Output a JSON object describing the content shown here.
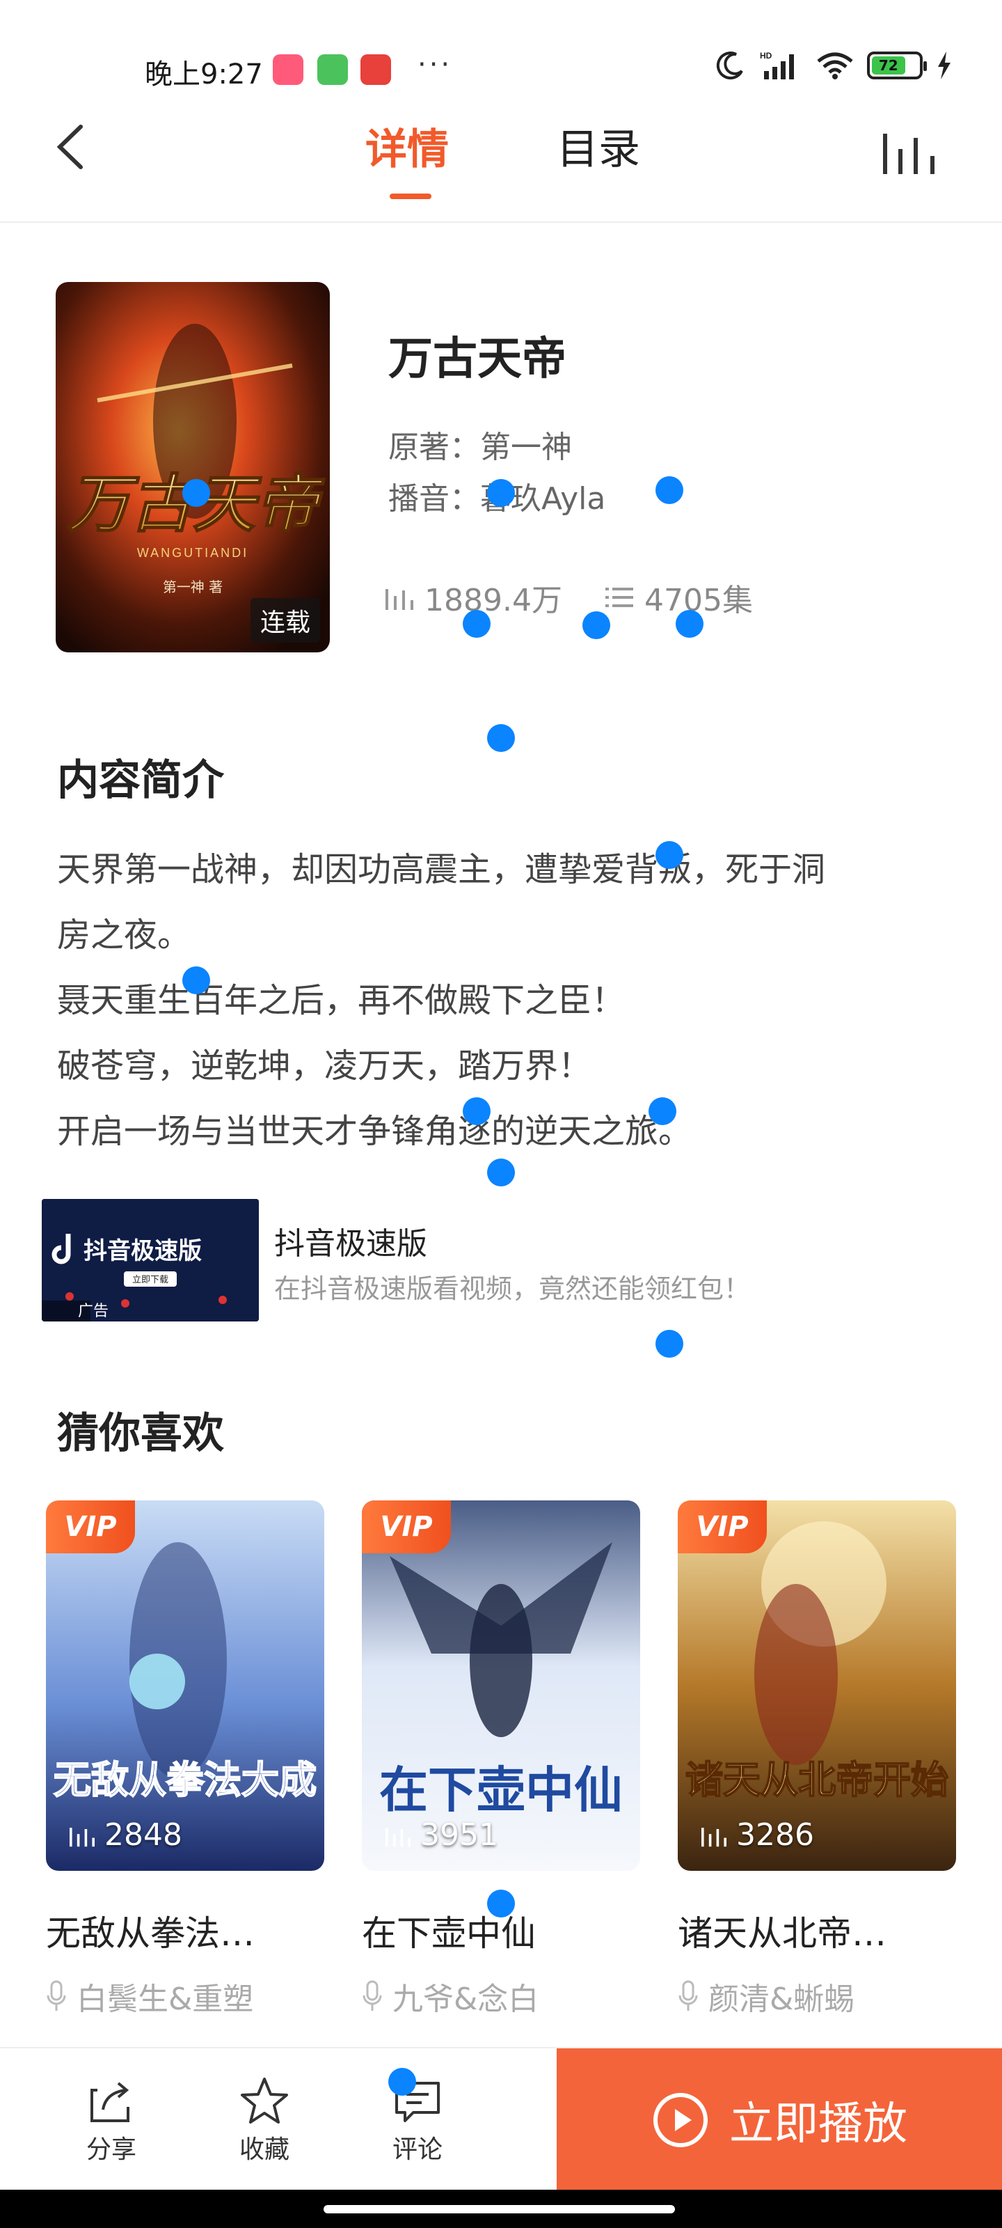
{
  "status_bar": {
    "time": "晚上9:27",
    "more": "···",
    "battery": "72",
    "network": "HD"
  },
  "header": {
    "tabs": [
      {
        "label": "详情",
        "active": true
      },
      {
        "label": "目录",
        "active": false
      }
    ]
  },
  "book": {
    "title": "万古天帝",
    "author_label": "原著：第一神",
    "narrator_label": "播音：暮玖Ayla",
    "plays": "1889.4万",
    "episodes": "4705集",
    "status_badge": "连载",
    "cover_text": "万古天帝",
    "cover_pinyin": "WANGUTIANDI",
    "cover_author": "第一神 著"
  },
  "intro": {
    "title": "内容简介",
    "lines": [
      "天界第一战神，却因功高震主，遭挚爱背叛，死于洞",
      "房之夜。",
      "聂天重生百年之后，再不做殿下之臣！",
      "破苍穹，逆乾坤，凌万天，踏万界！",
      "开启一场与当世天才争锋角逐的逆天之旅。"
    ]
  },
  "ad": {
    "image_text": "抖音极速版",
    "image_button": "立即下载",
    "ad_label": "广告",
    "title": "抖音极速版",
    "subtitle": "在抖音极速版看视频，竟然还能领红包！"
  },
  "recommend": {
    "title": "猜你喜欢",
    "vip_label": "VIP",
    "items": [
      {
        "name": "无敌从拳法…",
        "voice": "白鬓生&重塑",
        "plays": "2848",
        "cover_text": "无敌从拳法大成"
      },
      {
        "name": "在下壶中仙",
        "voice": "九爷&念白",
        "plays": "3951",
        "cover_text": "在下壶中仙"
      },
      {
        "name": "诸天从北帝…",
        "voice": "颜清&蜥蜴",
        "plays": "3286",
        "cover_text": "诸天从北帝开始"
      }
    ]
  },
  "bottom_bar": {
    "share": "分享",
    "favorite": "收藏",
    "comment": "评论",
    "play": "立即播放"
  },
  "colors": {
    "accent": "#f15a2b",
    "play_button": "#f4643a",
    "touch_dot": "#0a84ff"
  }
}
